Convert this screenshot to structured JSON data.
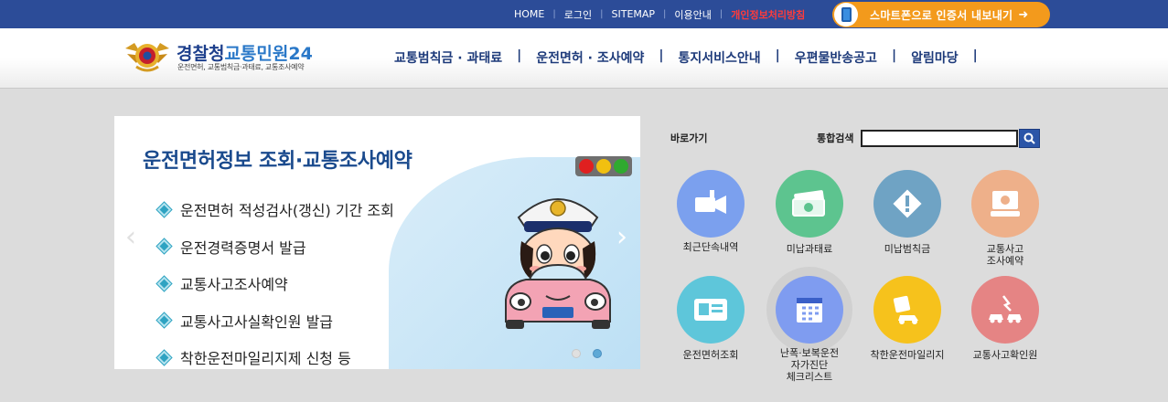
{
  "topbar": {
    "links": [
      "HOME",
      "로그인",
      "SITEMAP",
      "이용안내",
      "개인정보처리방침"
    ],
    "smartphone_banner": "스마트폰으로 인증서 내보내기",
    "arrow": "➜"
  },
  "header": {
    "logo_main": "경찰청",
    "logo_sub_name": "교통민원24",
    "logo_tagline": "운전면허, 교통범칙금·과태료, 교통조사예약",
    "nav": [
      "교통범칙금 · 과태료",
      "운전면허 · 조사예약",
      "통지서비스안내",
      "우편물반송공고",
      "알림마당"
    ]
  },
  "slider": {
    "title": "운전면허정보 조회·교통조사예약",
    "items": [
      "운전면허 적성검사(갱신) 기간 조회",
      "운전경력증명서 발급",
      "교통사고조사예약",
      "교통사고사실확인원 발급",
      "착한운전마일리지제 신청 등"
    ],
    "prev": "‹",
    "next": "›"
  },
  "quick": {
    "label": "바로가기",
    "search_label": "통합검색",
    "search_value": "",
    "tiles": [
      {
        "label": "최근단속내역",
        "color": "#7ba0ee",
        "icon": "camera-icon"
      },
      {
        "label": "미납과태료",
        "color": "#5dc48f",
        "icon": "money-icon"
      },
      {
        "label": "미납범칙금",
        "color": "#6fa3c4",
        "icon": "warning-icon"
      },
      {
        "label": "교통사고\n조사예약",
        "color": "#eeb08a",
        "icon": "monitor-icon"
      },
      {
        "label": "운전면허조회",
        "color": "#5ec6da",
        "icon": "id-card-icon"
      },
      {
        "label": "난폭·보복운전\n자가진단\n체크리스트",
        "color": "#7f9cf0",
        "icon": "calendar-check-icon"
      },
      {
        "label": "착한운전마일리지",
        "color": "#f6c21c",
        "icon": "mileage-car-icon"
      },
      {
        "label": "교통사고확인원",
        "color": "#e58484",
        "icon": "car-crash-icon"
      }
    ]
  }
}
